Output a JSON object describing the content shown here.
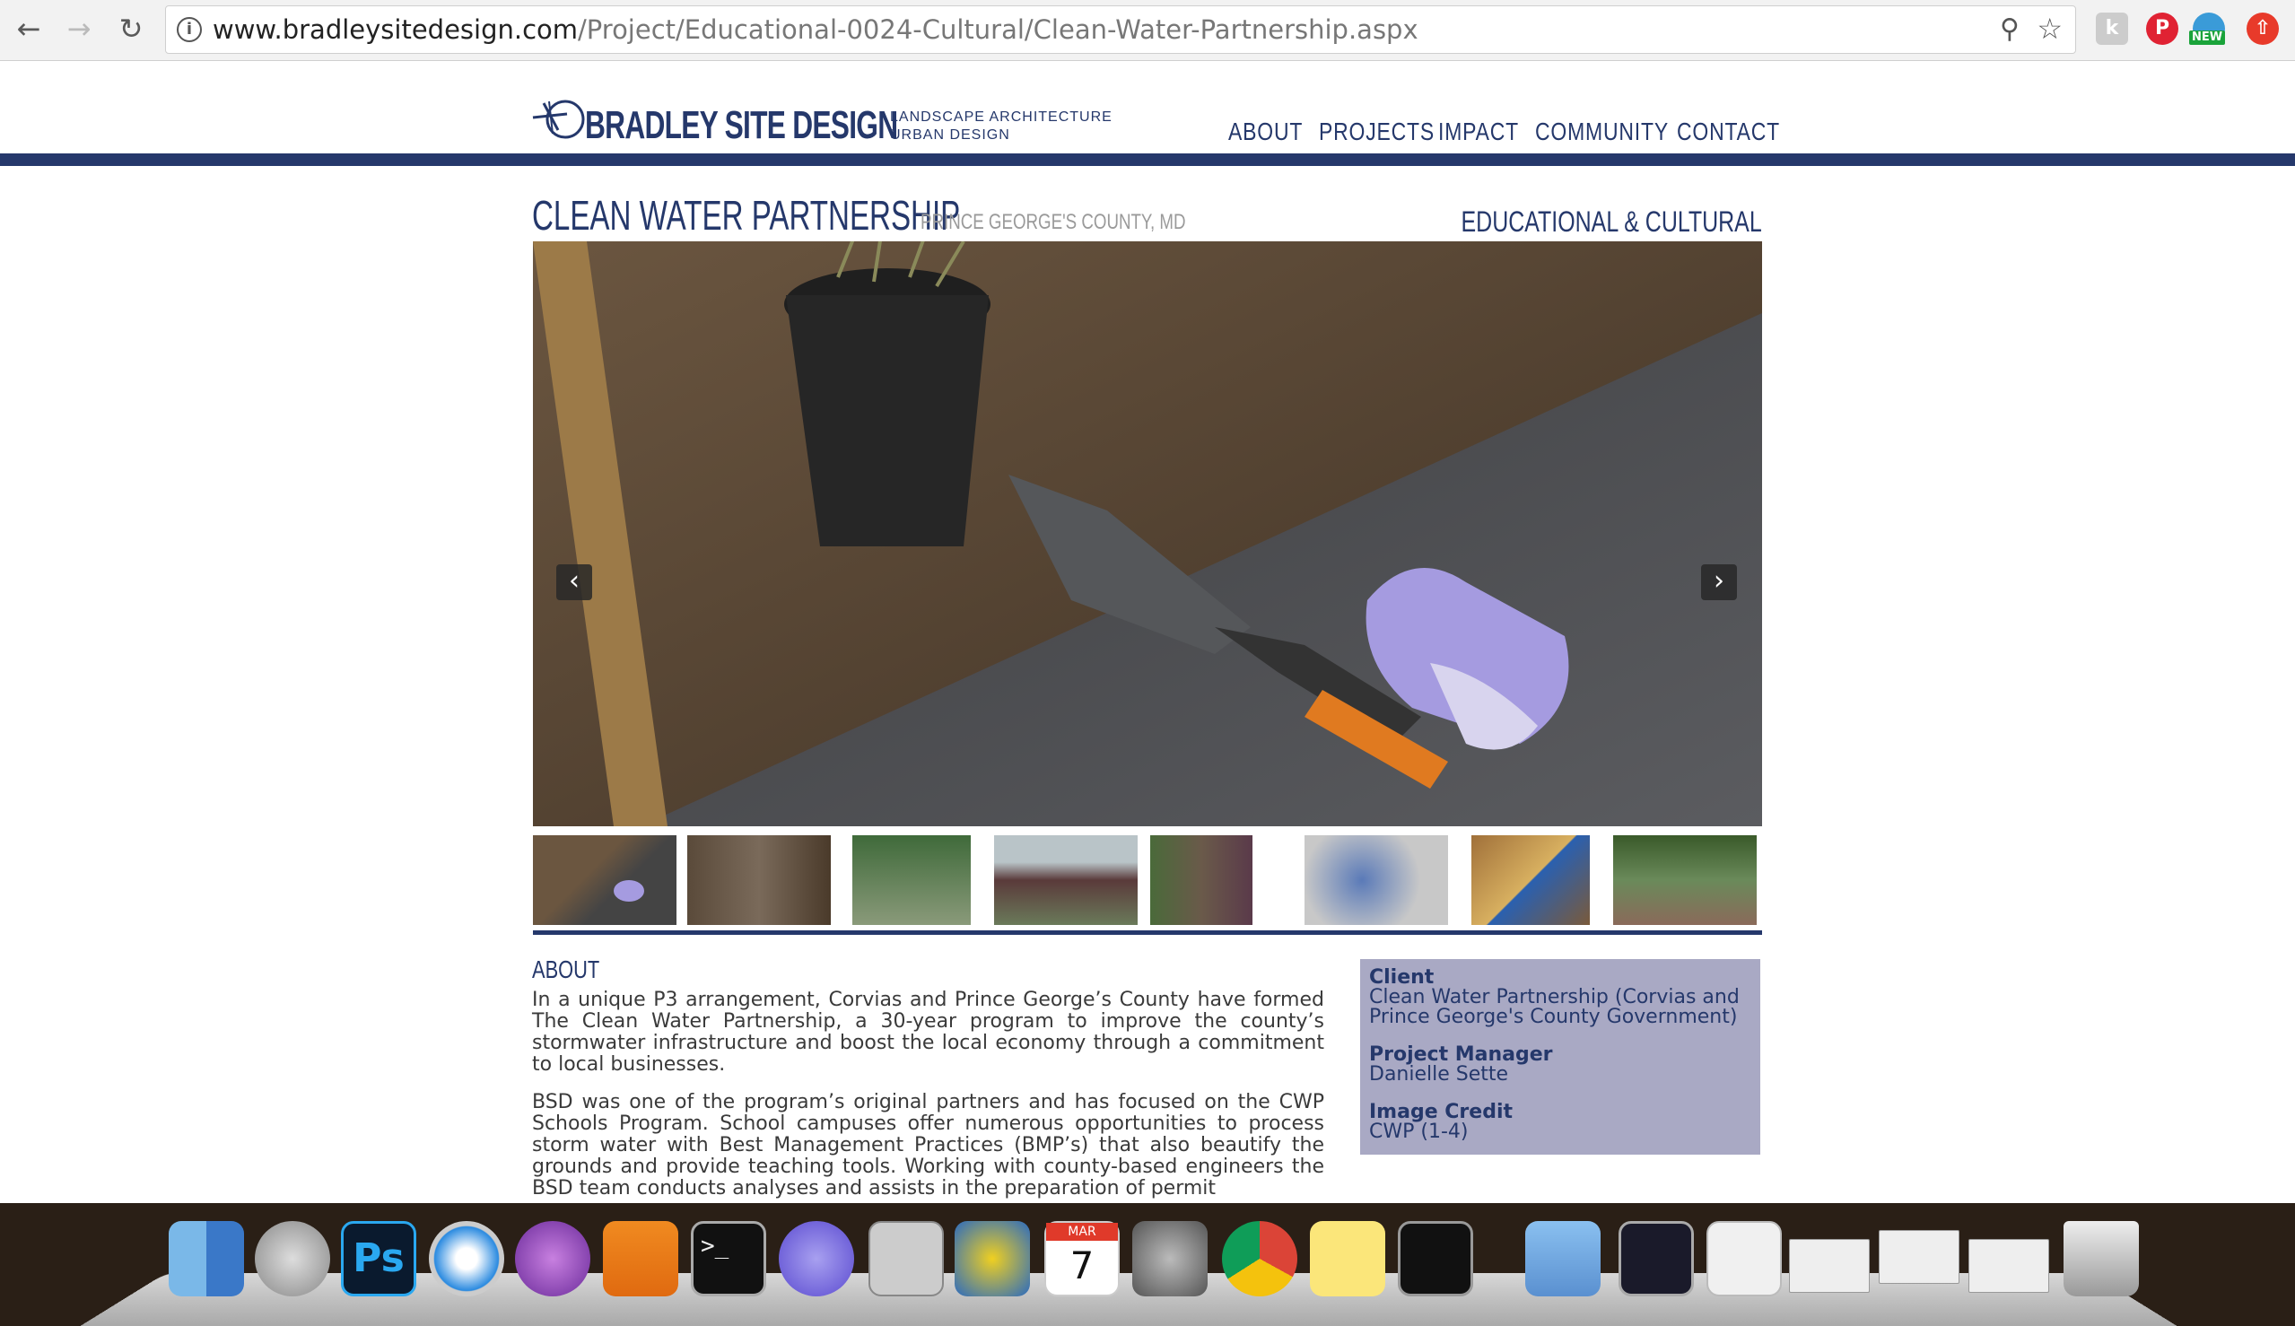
{
  "browser": {
    "url_domain": "www.bradleysitedesign.com",
    "url_path": "/Project/Educational-0024-Cultural/Clean-Water-Partnership.aspx",
    "ext_new_badge": "NEW"
  },
  "site": {
    "logo_name": "BRADLEY SITE DESIGN",
    "logo_tag1": "LANDSCAPE ARCHITECTURE",
    "logo_tag2": "URBAN DESIGN",
    "nav": [
      "ABOUT",
      "PROJECTS",
      "IMPACT",
      "COMMUNITY",
      "CONTACT"
    ],
    "colors": {
      "brand": "#25386b",
      "info_box": "#a9a9c4"
    }
  },
  "project": {
    "title": "CLEAN WATER PARTNERSHIP",
    "location": "PRINCE GEORGE'S COUNTY, MD",
    "category": "EDUCATIONAL & CULTURAL",
    "about_heading": "ABOUT",
    "about_p1": "In a unique P3 arrangement, Corvias and Prince George’s County have formed The Clean Water Partnership, a 30-year program to improve the county’s stormwater infrastructure and boost the local economy through a commitment to local businesses.",
    "about_p2": "BSD was one of the program’s original partners and has focused on the CWP Schools Program. School campuses offer numerous opportunities to process storm water with Best Management Practices (BMP’s) that also beautify the grounds and provide teaching tools. Working with county-based engineers the BSD team conducts analyses and assists in the preparation of permit",
    "client_label": "Client",
    "client_value": "Clean Water Partnership (Corvias and Prince George's County Government)",
    "pm_label": "Project Manager",
    "pm_value": "Danielle Sette",
    "credit_label": "Image Credit",
    "credit_value": "CWP (1-4)"
  },
  "dock": {
    "calendar_month": "MAR",
    "calendar_day": "7",
    "ps_label": "Ps",
    "icons": [
      "finder-icon",
      "launchpad-icon",
      "photoshop-icon",
      "safari-icon",
      "purple-app-icon",
      "vlc-icon",
      "terminal-icon",
      "torrent-icon",
      "calculator-icon",
      "cyberduck-icon",
      "calendar-icon",
      "system-preferences-icon",
      "chrome-icon",
      "stickies-icon",
      "activity-monitor-icon",
      "applications-folder-icon",
      "downloads-folder-icon",
      "document-icon",
      "window-thumbnail-icon",
      "window-thumbnail-icon",
      "window-thumbnail-icon",
      "trash-icon"
    ]
  }
}
